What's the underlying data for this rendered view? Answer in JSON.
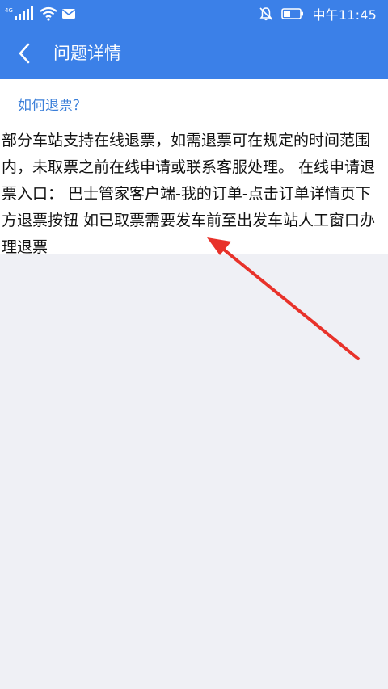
{
  "status_bar": {
    "network_label": "4G",
    "time": "中午11:45",
    "icons": [
      "signal-icon",
      "wifi-icon",
      "mail-icon",
      "mute-icon",
      "battery-icon"
    ]
  },
  "header": {
    "back_icon": "chevron-left-icon",
    "title": "问题详情"
  },
  "faq": {
    "question": "如何退票？",
    "answer": "部分车站支持在线退票，如需退票可在规定的时间范围内，未取票之前在线申请或联系客服处理。 在线申请退票入口： 巴士管家客户端-我的订单-点击订单详情页下方退票按钮 如已取票需要发车前至出发车站人工窗口办理退票"
  },
  "annotation": {
    "type": "arrow",
    "color": "#e8322a"
  },
  "colors": {
    "brand_blue": "#3b80e8",
    "question_blue": "#3b7fd9",
    "page_background": "#eff0f5"
  }
}
